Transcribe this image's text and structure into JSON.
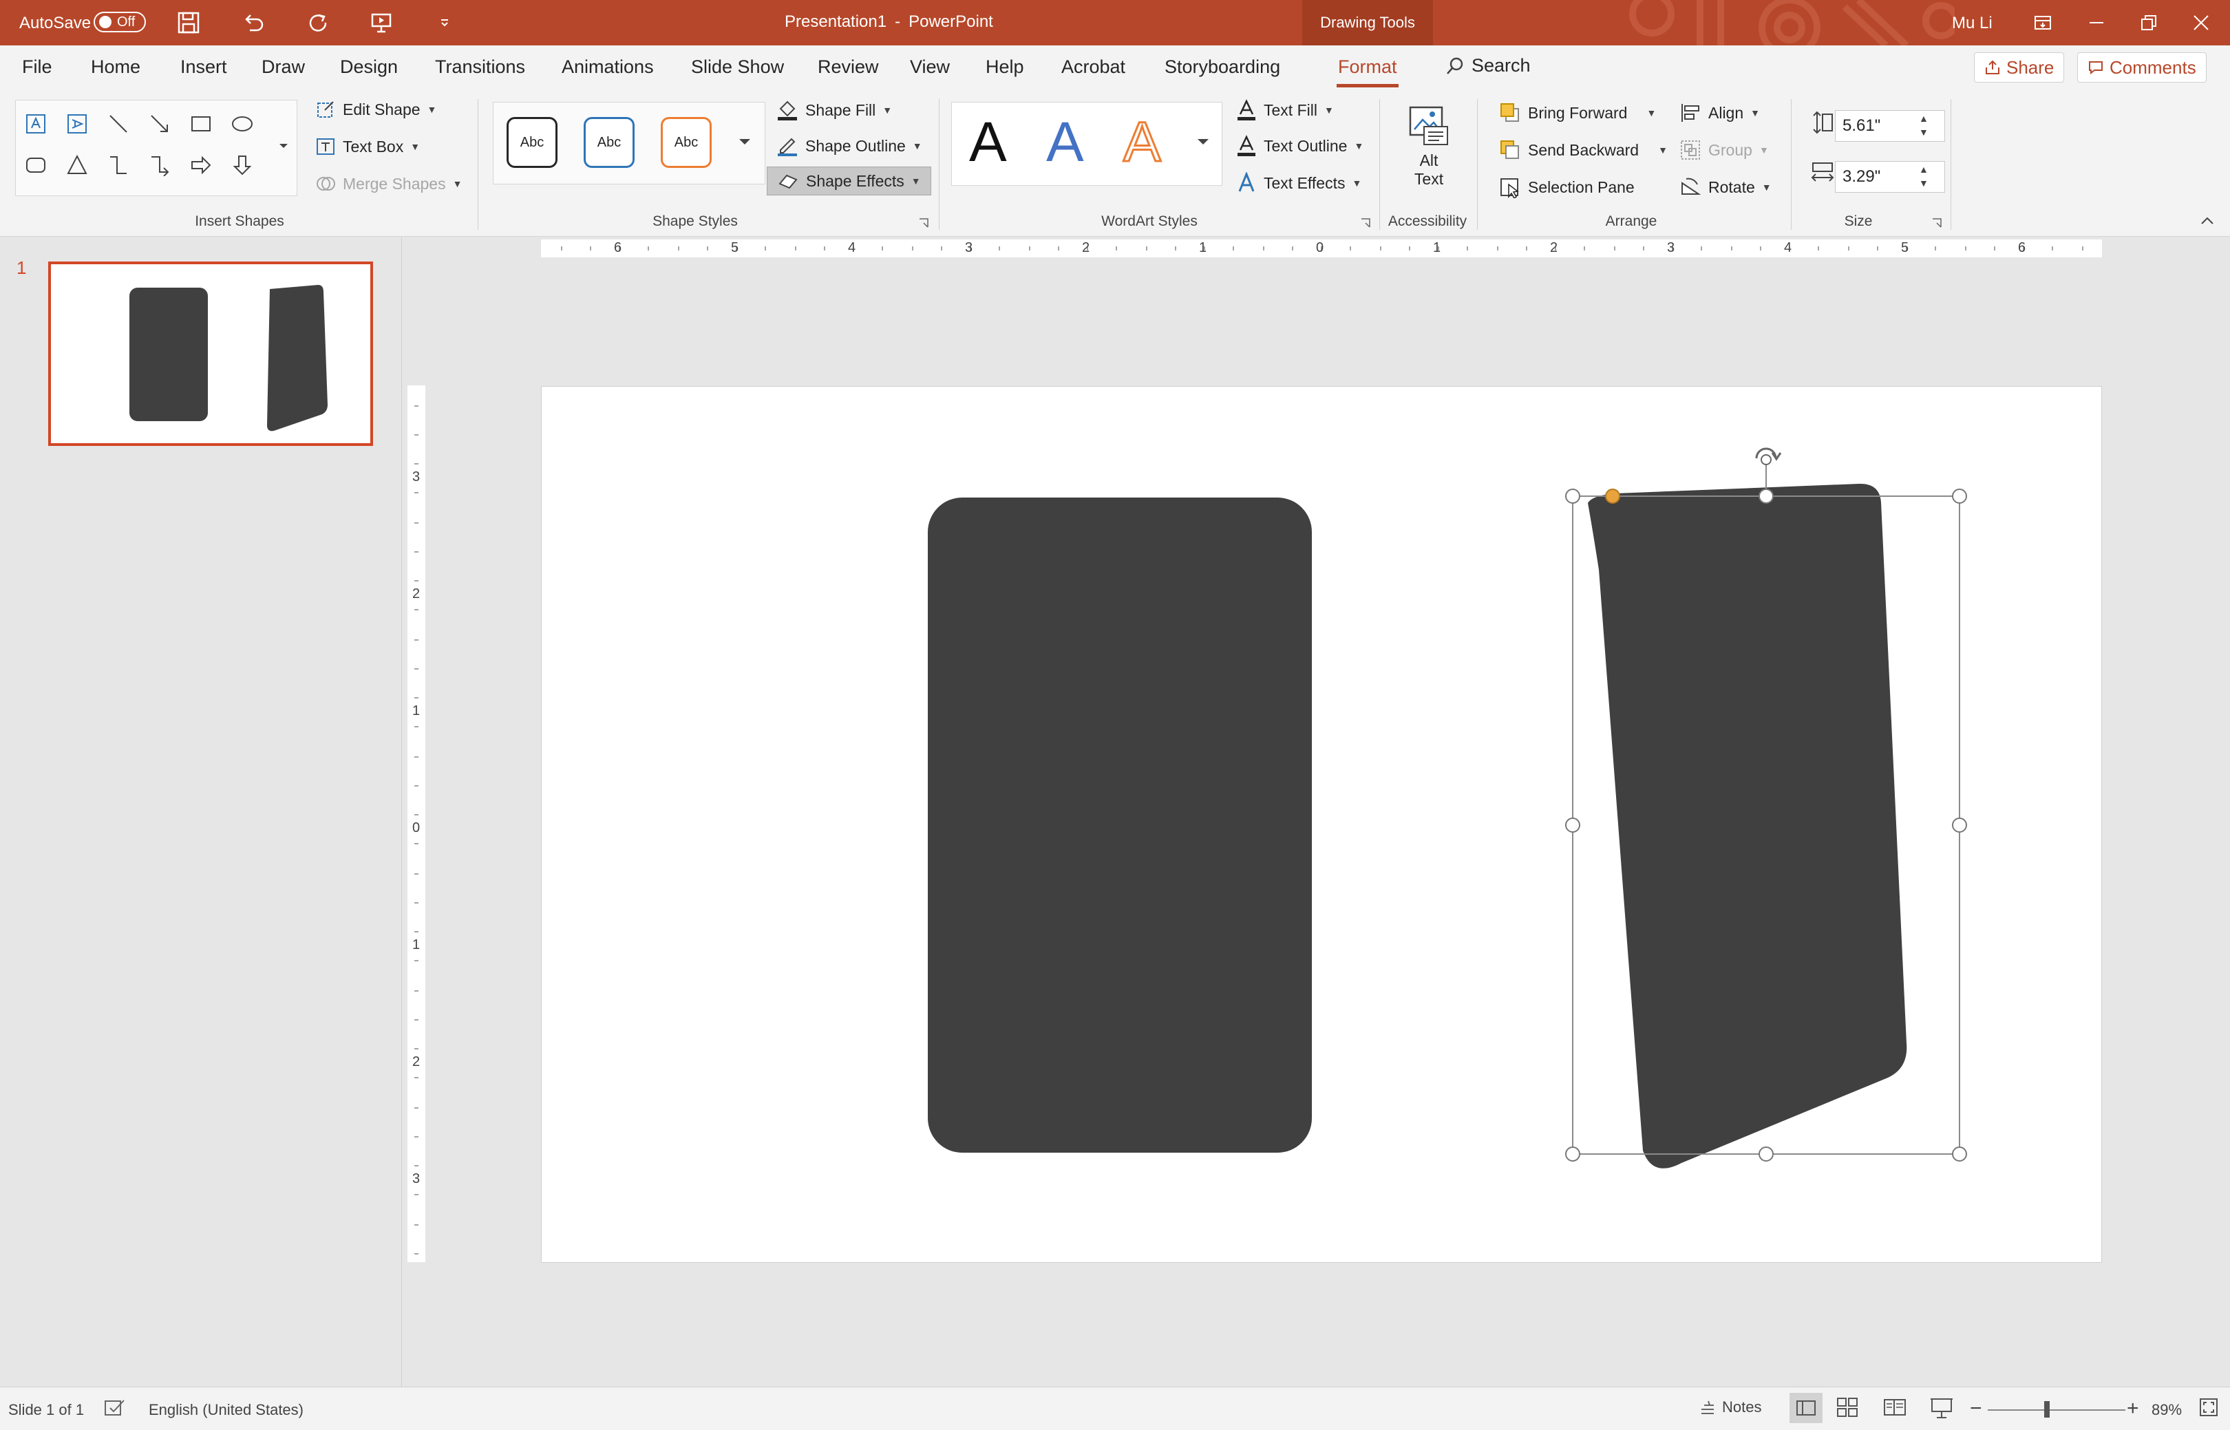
{
  "titlebar": {
    "autosave_label": "AutoSave",
    "autosave_state": "Off",
    "doc_title": "Presentation1",
    "separator": "-",
    "app_name": "PowerPoint",
    "context_tab": "Drawing Tools",
    "user": "Mu Li"
  },
  "menu": {
    "tabs": [
      "File",
      "Home",
      "Insert",
      "Draw",
      "Design",
      "Transitions",
      "Animations",
      "Slide Show",
      "Review",
      "View",
      "Help",
      "Acrobat",
      "Storyboarding",
      "Format"
    ],
    "active_tab": "Format",
    "search": "Search",
    "share": "Share",
    "comments": "Comments"
  },
  "ribbon": {
    "insert_shapes": {
      "edit_shape": "Edit Shape",
      "text_box": "Text Box",
      "merge_shapes": "Merge Shapes",
      "label": "Insert Shapes"
    },
    "shape_styles": {
      "samples": [
        "Abc",
        "Abc",
        "Abc"
      ],
      "shape_fill": "Shape Fill",
      "shape_outline": "Shape Outline",
      "shape_effects": "Shape Effects",
      "label": "Shape Styles"
    },
    "wordart": {
      "samples": [
        "A",
        "A",
        "A"
      ],
      "text_fill": "Text Fill",
      "text_outline": "Text Outline",
      "text_effects": "Text Effects",
      "label": "WordArt Styles"
    },
    "accessibility": {
      "alt_text_line1": "Alt",
      "alt_text_line2": "Text",
      "label": "Accessibility"
    },
    "arrange": {
      "bring_forward": "Bring Forward",
      "send_backward": "Send Backward",
      "selection_pane": "Selection Pane",
      "align": "Align",
      "group": "Group",
      "rotate": "Rotate",
      "label": "Arrange"
    },
    "size": {
      "height": "5.61\"",
      "width": "3.29\"",
      "label": "Size"
    }
  },
  "ruler": {
    "h_numbers": [
      "6",
      "5",
      "4",
      "3",
      "2",
      "1",
      "0",
      "1",
      "2",
      "3",
      "4",
      "5",
      "6"
    ],
    "v_numbers": [
      "3",
      "2",
      "1",
      "0",
      "1",
      "2",
      "3"
    ]
  },
  "thumbnails": [
    {
      "number": "1"
    }
  ],
  "statusbar": {
    "slide_info": "Slide 1 of 1",
    "language": "English (United States)",
    "notes": "Notes",
    "zoom": "89%"
  },
  "colors": {
    "brand": "#b7472a",
    "shape_fill": "#404040",
    "adjust_handle": "#e8a33d"
  }
}
